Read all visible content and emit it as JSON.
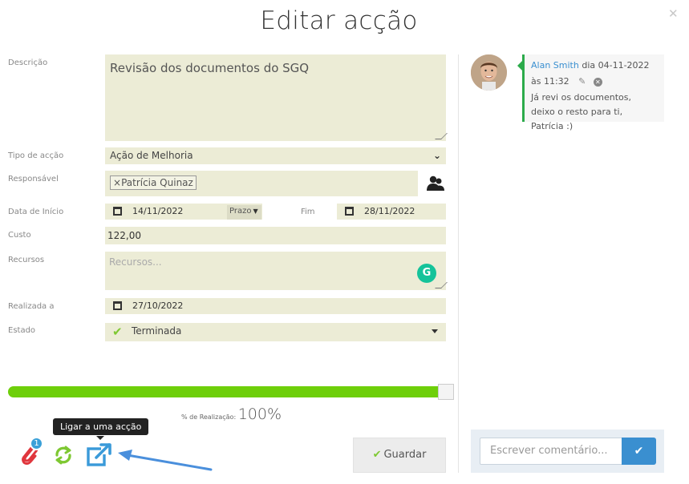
{
  "modal": {
    "title": "Editar acção",
    "close_icon": "close-icon"
  },
  "form": {
    "descricao": {
      "label": "Descrição",
      "value": "Revisão dos documentos do SGQ"
    },
    "tipo_accao": {
      "label": "Tipo de acção",
      "value": "Ação de Melhoria"
    },
    "responsavel": {
      "label": "Responsável",
      "tag_remove": "×",
      "tag": "Patrícia Quinaz",
      "icon": "people-icon"
    },
    "data_inicio": {
      "label": "Data de Início",
      "value": "14/11/2022",
      "prazo": "Prazo"
    },
    "fim": {
      "label": "Fim",
      "value": "28/11/2022"
    },
    "custo": {
      "label": "Custo",
      "value": "122,00"
    },
    "recursos": {
      "label": "Recursos",
      "placeholder": "Recursos..."
    },
    "realizada": {
      "label": "Realizada a",
      "value": "27/10/2022"
    },
    "estado": {
      "label": "Estado",
      "value": "Terminada"
    }
  },
  "progress": {
    "label": "% de Realização:",
    "display": "100%",
    "percent": 100,
    "color": "#6ecf0a"
  },
  "toolbar": {
    "attachments_badge": "1",
    "tooltip": "Ligar a uma acção",
    "save_label": "Guardar"
  },
  "comments": [
    {
      "author": "Alan Smith",
      "meta": "dia 04-11-2022 às 11:32",
      "text": "Já revi os documentos, deixo o resto para ti, Patrícia :)"
    }
  ],
  "comment_input": {
    "placeholder": "Escrever comentário..."
  },
  "colors": {
    "field_bg": "#ececd6",
    "accent_green": "#6ecf0a",
    "accent_blue": "#3a8fd0",
    "comment_border": "#2cab4b"
  }
}
